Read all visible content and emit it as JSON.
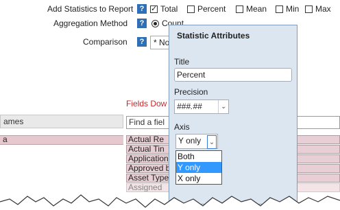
{
  "stats_row": {
    "label": "Add Statistics to Report",
    "help": "?",
    "options": [
      {
        "label": "Total",
        "checked": true
      },
      {
        "label": "Percent",
        "checked": false
      },
      {
        "label": "Mean",
        "checked": false
      },
      {
        "label": "Min",
        "checked": false
      },
      {
        "label": "Max",
        "checked": false
      }
    ]
  },
  "aggregation": {
    "label": "Aggregation Method",
    "help": "?",
    "selected_option": "Count"
  },
  "comparison": {
    "label": "Comparison",
    "help": "?",
    "value": "* None *"
  },
  "left_panel": {
    "header": "ames",
    "highlighted_row": "a"
  },
  "fields": {
    "title": "Fields Dow",
    "search_placeholder": "Find a fiel",
    "items": [
      "Actual Re",
      "Actual Tin",
      "Application",
      "Approved b",
      "Asset Type",
      "Assigned"
    ]
  },
  "popup": {
    "title": "Statistic Attributes",
    "title_label": "Title",
    "title_value": "Percent",
    "precision_label": "Precision",
    "precision_value": "###.##",
    "axis_label": "Axis",
    "axis_value": "Y only",
    "axis_options": [
      "Both",
      "Y only",
      "X only"
    ],
    "axis_selected": "Y only"
  },
  "icons": {
    "help": "help-icon",
    "dropdown": "chevron-down-icon"
  },
  "colors": {
    "help_bg": "#2f6fb5",
    "popup_bg": "#dce6f1",
    "section_title": "#c4262e",
    "row_pink": "#e8cfd5",
    "dropdown_selected": "#3399ff"
  }
}
